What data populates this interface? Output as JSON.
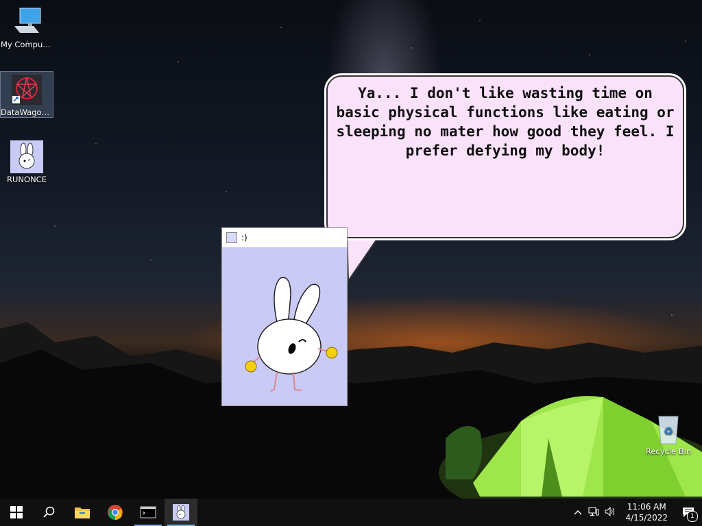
{
  "desktop": {
    "icons": [
      {
        "label": "My Computer"
      },
      {
        "label": "DataWagon..."
      },
      {
        "label": "RUNONCE"
      },
      {
        "label": "Recycle Bin"
      }
    ]
  },
  "speech_bubble": {
    "text": "Ya... I don't like wasting time on basic physical functions like eating or sleeping no mater how good they feel. I prefer defying my body!"
  },
  "pet_window": {
    "title": ":)"
  },
  "taskbar": {
    "items": [
      "start-icon",
      "search-icon",
      "file-explorer-icon",
      "chrome-icon",
      "terminal-icon",
      "pet-app-icon"
    ],
    "clock_time": "11:06 AM",
    "clock_date": "4/15/2022",
    "notification_count": "1"
  },
  "colors": {
    "bubble_fill": "#fbe2fb",
    "pet_bg": "#cacaf6",
    "tent_green": "#9ee64a",
    "taskbar": "#101010"
  }
}
